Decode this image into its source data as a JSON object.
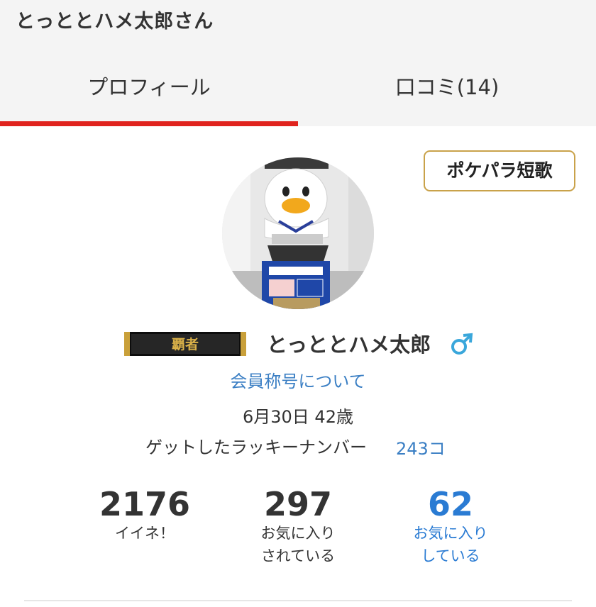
{
  "header": {
    "title": "とっととハメ太郎さん",
    "tabs": [
      {
        "label": "プロフィール",
        "active": true
      },
      {
        "label": "口コミ(14)",
        "active": false
      }
    ]
  },
  "profile": {
    "tanka_button": "ポケパラ短歌",
    "title_badge": "覇者",
    "name": "とっととハメ太郎",
    "gender_icon": "male-icon",
    "member_title_link": "会員称号について",
    "birthday": "6月30日 42歳",
    "lucky_label": "ゲットしたラッキーナンバー",
    "lucky_count": "243コ"
  },
  "stats": [
    {
      "value": "2176",
      "label": "イイネ！"
    },
    {
      "value": "297",
      "label": "お気に入り\nされている"
    },
    {
      "value": "62",
      "label": "お気に入り\nしている"
    }
  ],
  "colors": {
    "accent_red": "#e0231e",
    "link_blue": "#3b7fc4",
    "gold_border": "#c9a24a",
    "male_icon": "#3aa7db"
  }
}
